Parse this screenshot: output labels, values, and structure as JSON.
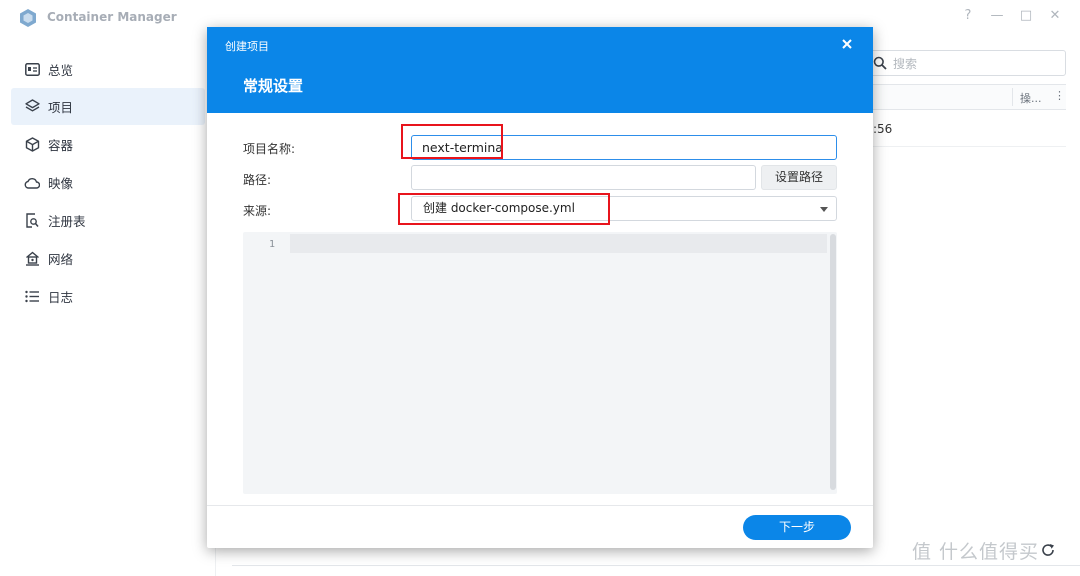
{
  "window": {
    "title": "Container Manager",
    "controls": [
      "?",
      "—",
      "□",
      "✕"
    ]
  },
  "sidebar": {
    "items": [
      {
        "label": "总览",
        "icon": "overview-icon"
      },
      {
        "label": "项目",
        "icon": "layers-icon",
        "active": true
      },
      {
        "label": "容器",
        "icon": "cube-icon"
      },
      {
        "label": "映像",
        "icon": "cloud-icon"
      },
      {
        "label": "注册表",
        "icon": "registry-search-icon"
      },
      {
        "label": "网络",
        "icon": "network-home-icon"
      },
      {
        "label": "日志",
        "icon": "list-icon"
      }
    ]
  },
  "background": {
    "search_placeholder": "搜索",
    "column_op": "操...",
    "column_more": "⋮",
    "row_time": ":56",
    "watermark": "值 什么值得买"
  },
  "dialog": {
    "title": "创建项目",
    "subtitle": "常规设置",
    "project_name_label": "项目名称:",
    "project_name_value": "next-termina",
    "path_label": "路径:",
    "path_value": "",
    "set_path_button": "设置路径",
    "source_label": "来源:",
    "source_value": "创建 docker-compose.yml",
    "editor_line_number": "1",
    "next_button": "下一步"
  },
  "colors": {
    "accent": "#0b86e8",
    "annotation": "#e8141c",
    "active_nav_bg": "#eaf2fb"
  }
}
